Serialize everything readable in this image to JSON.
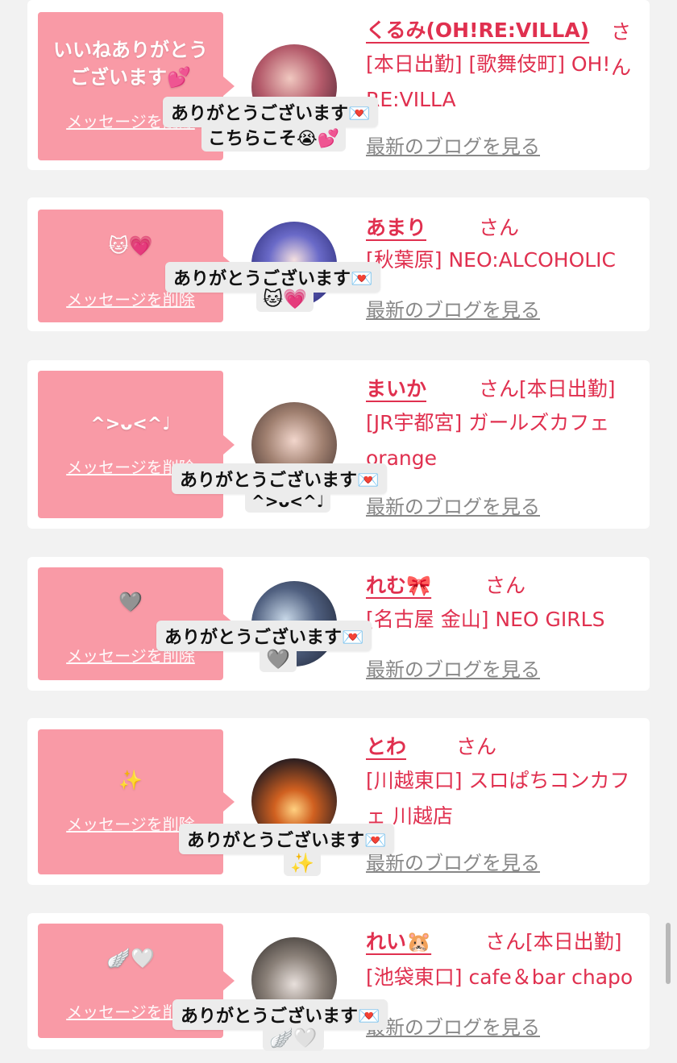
{
  "colors": {
    "accent": "#e0304f",
    "bubble": "#f99aa6",
    "background": "#f2f2f2"
  },
  "items": [
    {
      "bubble_text": "いいねありがとうございます💕",
      "delete_label": "メッセージを削除",
      "name": "くるみ(OH!RE:VILLA)",
      "san": "さん",
      "shop": "[本日出勤] [歌舞伎町] OH! RE:VILLA",
      "blog": "最新のブログを見る",
      "overlay_line1": "ありがとうございます💌",
      "overlay_line2": "こちらこそ😭💕"
    },
    {
      "bubble_text": "🐱💗",
      "delete_label": "メッセージを削除",
      "name": "あまり",
      "san": "さん",
      "shop": "[秋葉原] NEO:ALCOHOLIC",
      "blog": "最新のブログを見る",
      "overlay_line1": "ありがとうございます💌",
      "overlay_line2": "🐱💗"
    },
    {
      "bubble_text": "^>ᴗ<^♩",
      "delete_label": "メッセージを削除",
      "name": "まいか",
      "san": "さん[本日出勤]",
      "shop": "[JR宇都宮] ガールズカフェorange",
      "blog": "最新のブログを見る",
      "overlay_line1": "ありがとうございます💌",
      "overlay_line2": "^>ᴗ<^♩"
    },
    {
      "bubble_text": "🩶",
      "delete_label": "メッセージを削除",
      "name": "れむ🎀",
      "san": "さん",
      "shop": "[名古屋 金山] NEO GIRLS",
      "blog": "最新のブログを見る",
      "overlay_line1": "ありがとうございます💌",
      "overlay_line2": "🩶"
    },
    {
      "bubble_text": "✨",
      "delete_label": "メッセージを削除",
      "name": "とわ",
      "san": "さん",
      "shop": "[川越東口] スロぱちコンカフェ 川越店",
      "blog": "最新のブログを見る",
      "overlay_line1": "ありがとうございます💌",
      "overlay_line2": "✨"
    },
    {
      "bubble_text": "🪽🤍",
      "delete_label": "メッセージを削除",
      "name": "れい🐹",
      "san": "さん[本日出勤]",
      "shop": "[池袋東口] cafe＆bar chapo",
      "blog": "最新のブログを見る",
      "overlay_line1": "ありがとうございます💌",
      "overlay_line2": "🪽🤍"
    }
  ]
}
